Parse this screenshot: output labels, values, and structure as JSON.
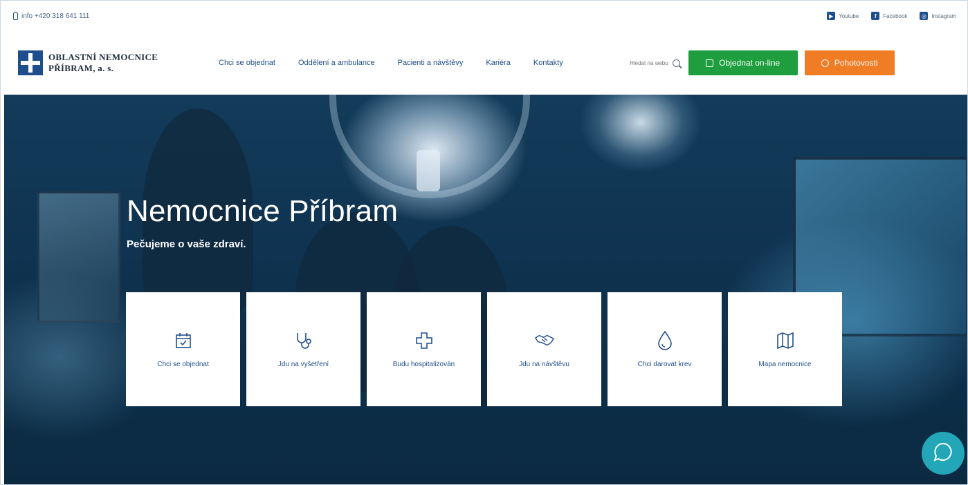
{
  "topbar": {
    "contact": "info +420 318 641 111",
    "socials": [
      {
        "label": "Youtube",
        "icon": "youtube-icon"
      },
      {
        "label": "Facebook",
        "icon": "facebook-icon"
      },
      {
        "label": "Instagram",
        "icon": "instagram-icon"
      }
    ]
  },
  "header": {
    "logo_line1": "OBLASTNÍ NEMOCNICE",
    "logo_line2": "PŘÍBRAM, a. s.",
    "nav": [
      {
        "label": "Chci se objednat"
      },
      {
        "label": "Oddělení a ambulance"
      },
      {
        "label": "Pacienti a návštěvy"
      },
      {
        "label": "Kariéra"
      },
      {
        "label": "Kontakty"
      }
    ],
    "search_placeholder": "Hledat na webu",
    "order_button": "Objednat on-line",
    "emergency_button": "Pohotovosti"
  },
  "hero": {
    "title": "Nemocnice Příbram",
    "subtitle": "Pečujeme o vaše zdraví."
  },
  "cards": [
    {
      "label": "Chci se objednat",
      "icon": "calendar-check-icon"
    },
    {
      "label": "Jdu na vyšetření",
      "icon": "stethoscope-icon"
    },
    {
      "label": "Budu hospitalizován",
      "icon": "medical-cross-icon"
    },
    {
      "label": "Jdu na návštěvu",
      "icon": "handshake-icon"
    },
    {
      "label": "Chci darovat krev",
      "icon": "blood-drop-icon"
    },
    {
      "label": "Mapa nemocnice",
      "icon": "map-icon"
    }
  ],
  "colors": {
    "brand_blue": "#1f4e8c",
    "order_green": "#1e9e3e",
    "emergency_orange": "#f07c24",
    "chat_teal": "#22a6b8"
  },
  "chat": {
    "icon": "chat-bubble-icon"
  }
}
